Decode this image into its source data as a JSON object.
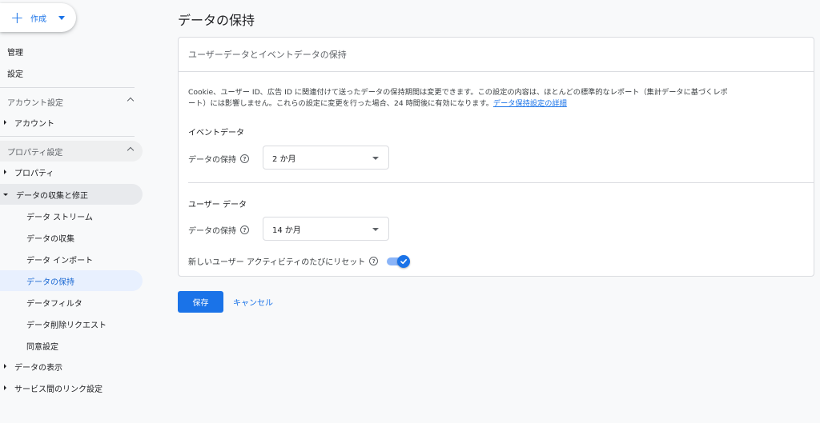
{
  "sidebar": {
    "create_label": "作成",
    "admin": "管理",
    "settings": "設定",
    "account_section": "アカウント設定",
    "account_item": "アカウント",
    "property_section": "プロパティ設定",
    "property_item": "プロパティ",
    "data_collection_group": "データの収集と修正",
    "sub_items": [
      "データ ストリーム",
      "データの収集",
      "データ インポート",
      "データの保持",
      "データフィルタ",
      "データ削除リクエスト",
      "同意設定"
    ],
    "active_sub_item": "データの保持",
    "data_display": "データの表示",
    "service_links": "サービス間のリンク設定"
  },
  "main": {
    "title": "データの保持",
    "card_header": "ユーザーデータとイベントデータの保持",
    "description_line1": "Cookie、ユーザー ID、広告 ID に関連付けて送ったデータの保持期間は変更できます。この設定の内容は、ほとんどの標準的なレポート（集計データに基づくレポ",
    "description_line2": "ート）には影響しません。これらの設定に変更を行った場合、24 時間後に有効になります。",
    "description_link": "データ保持設定の詳細",
    "event_section": "イベントデータ",
    "event_retention_label": "データの保持",
    "event_retention_value": "2 か月",
    "user_section": "ユーザー データ",
    "user_retention_label": "データの保持",
    "user_retention_value": "14 か月",
    "reset_label": "新しいユーザー アクティビティのたびにリセット",
    "reset_enabled": true,
    "help_glyph": "?"
  },
  "actions": {
    "save": "保存",
    "cancel": "キャンセル"
  },
  "colors": {
    "accent": "#1a73e8",
    "active_bg": "#e8f0fe"
  }
}
